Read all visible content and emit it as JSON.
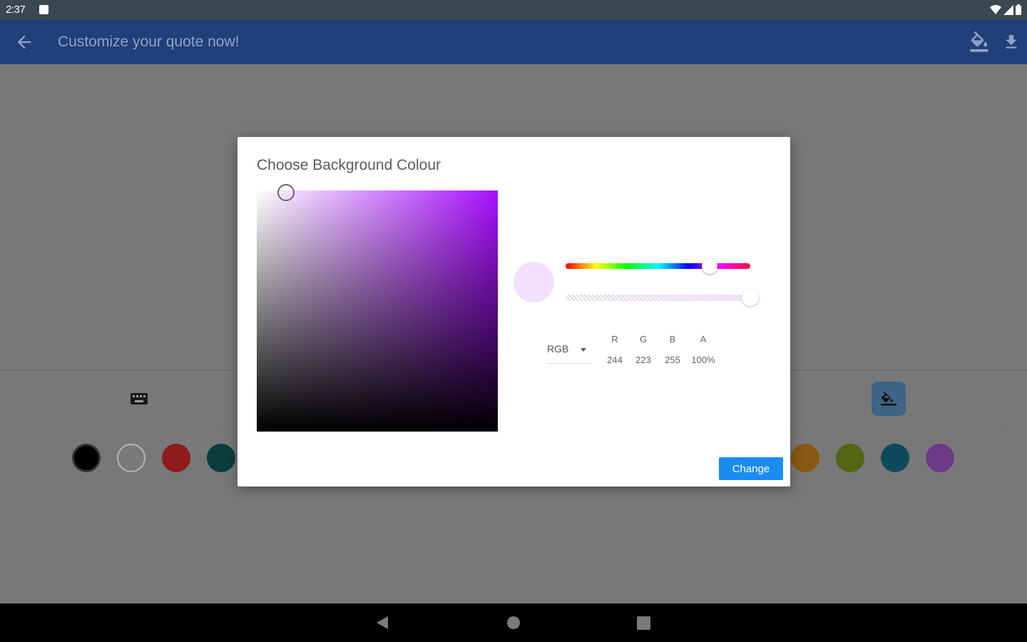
{
  "status_bar": {
    "time": "2:37",
    "icons": [
      "notification-icon",
      "wifi-icon",
      "signal-icon",
      "battery-icon"
    ]
  },
  "app_bar": {
    "title": "Customize your quote now!",
    "icons": [
      "back-arrow-icon",
      "paint-bucket-icon",
      "download-icon"
    ]
  },
  "toolbar": {
    "icons": [
      "keyboard-icon",
      "paint-bucket-icon"
    ],
    "swatches": [
      "#000000",
      "#ffffff",
      "#c62020",
      "#0d4a4a",
      "#c2740a",
      "#6a8a1a",
      "#0f5a70",
      "#8a4ab0"
    ]
  },
  "dialog": {
    "title": "Choose Background Colour",
    "hue_position": 0.78,
    "alpha_position": 1.0,
    "selected_color": "#f4dfff",
    "mode": "RGB",
    "channels": [
      {
        "label": "R",
        "value": "244"
      },
      {
        "label": "G",
        "value": "223"
      },
      {
        "label": "B",
        "value": "255"
      },
      {
        "label": "A",
        "value": "100%"
      }
    ],
    "button_label": "Change"
  },
  "navigation": {
    "icons": [
      "nav-back-icon",
      "nav-home-icon",
      "nav-recents-icon"
    ]
  }
}
